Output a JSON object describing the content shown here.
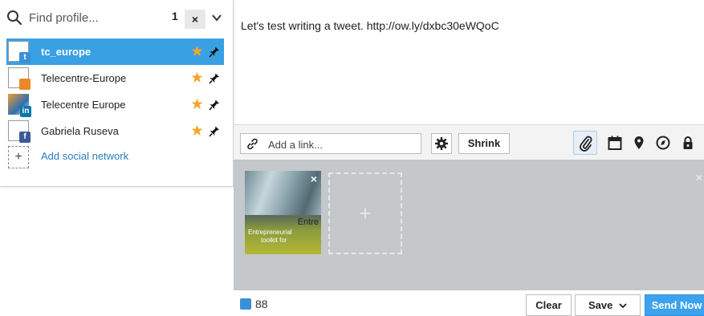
{
  "search": {
    "placeholder": "Find profile...",
    "selected_count": "1",
    "clear_symbol": "×"
  },
  "profiles": [
    {
      "name": "tc_europe",
      "network": "twitter",
      "selected": true,
      "favorite": true,
      "pinned": true
    },
    {
      "name": "Telecentre-Europe",
      "network": "other",
      "selected": false,
      "favorite": true,
      "pinned": true
    },
    {
      "name": "Telecentre Europe",
      "network": "linkedin",
      "selected": false,
      "favorite": true,
      "pinned": true
    },
    {
      "name": "Gabriela Ruseva",
      "network": "facebook",
      "selected": false,
      "favorite": true,
      "pinned": true
    }
  ],
  "add_network": {
    "label": "Add social network",
    "symbol": "+"
  },
  "compose": {
    "message": "Let's test writing a tweet.  http://ow.ly/dxbc30eWQoC"
  },
  "toolbar": {
    "link_placeholder": "Add a link...",
    "shrink_label": "Shrink",
    "icons": [
      "link-icon",
      "gear-icon",
      "paperclip-icon",
      "calendar-icon",
      "location-pin-icon",
      "targeting-icon",
      "lock-icon"
    ]
  },
  "media": {
    "thumbnail_title": "Entre",
    "thumbnail_line1": "Entrepreneurial",
    "thumbnail_line2": "toolkit for",
    "remove_symbol": "×",
    "add_symbol": "+"
  },
  "footer": {
    "char_count": "88",
    "clear_label": "Clear",
    "save_label": "Save",
    "send_label": "Send Now"
  },
  "colors": {
    "selected_row": "#3aa0e4",
    "send_button": "#3da2ee",
    "star": "#f5a623",
    "media_bg": "#c4c8cb",
    "link_text": "#2a7bbd"
  }
}
